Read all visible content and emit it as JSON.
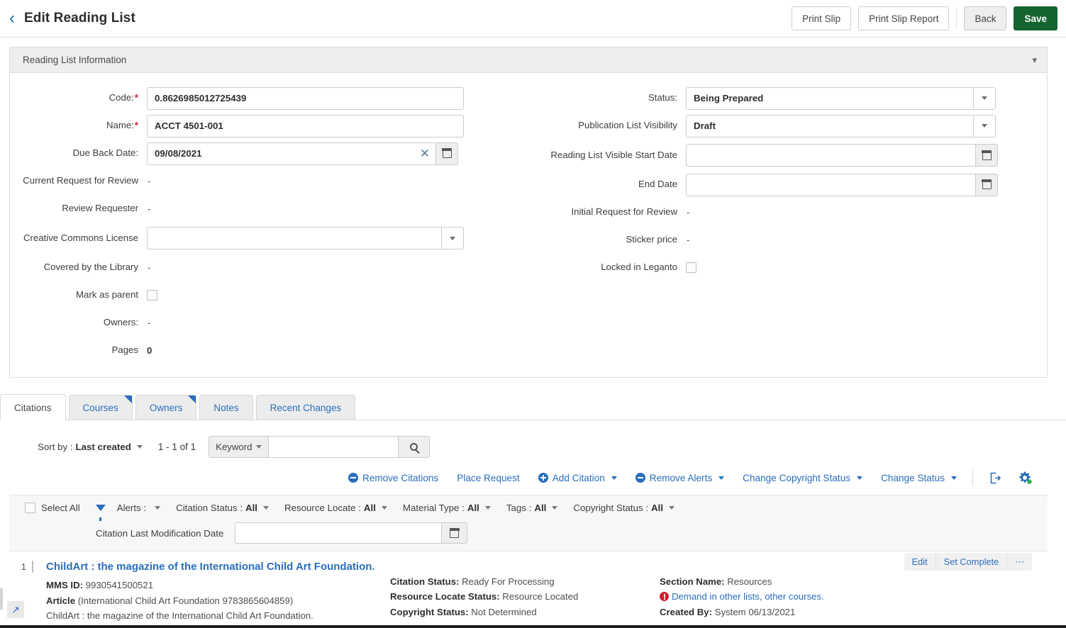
{
  "header": {
    "back_icon": "chevron-left-icon",
    "title": "Edit Reading List",
    "buttons": {
      "print_slip": "Print Slip",
      "print_slip_report": "Print Slip Report",
      "back": "Back",
      "save": "Save"
    },
    "save_color": "#14642f"
  },
  "panel": {
    "title": "Reading List Information",
    "collapse_icon": "chevron-down-icon",
    "left_fields": [
      {
        "label": "Code:",
        "required": true,
        "type": "text",
        "value": "0.8626985012725439"
      },
      {
        "label": "Name:",
        "required": true,
        "type": "text",
        "value": "ACCT 4501-001"
      },
      {
        "label": "Due Back Date:",
        "required": false,
        "type": "date",
        "value": "09/08/2021",
        "clear_icon": "clear-x-icon",
        "calendar_icon": "calendar-icon"
      },
      {
        "label": "Current Request for Review",
        "required": false,
        "type": "static",
        "value": "-"
      },
      {
        "label": "Review Requester",
        "required": false,
        "type": "static",
        "value": "-"
      },
      {
        "label": "Creative Commons License",
        "required": false,
        "type": "select",
        "value": ""
      },
      {
        "label": "Covered by the Library",
        "required": false,
        "type": "static",
        "value": "-"
      },
      {
        "label": "Mark as parent",
        "required": false,
        "type": "checkbox",
        "checked": false
      },
      {
        "label": "Owners:",
        "required": false,
        "type": "static",
        "value": "-"
      },
      {
        "label": "Pages",
        "required": false,
        "type": "static-bold",
        "value": "0"
      }
    ],
    "right_fields": [
      {
        "label": "Status:",
        "required": false,
        "type": "select",
        "value": "Being Prepared"
      },
      {
        "label": "Publication List Visibility",
        "required": false,
        "type": "select",
        "value": "Draft"
      },
      {
        "label": "Reading List Visible Start Date",
        "required": false,
        "type": "date",
        "value": "",
        "calendar_icon": "calendar-icon"
      },
      {
        "label": "End Date",
        "required": false,
        "type": "date",
        "value": "",
        "calendar_icon": "calendar-icon"
      },
      {
        "label": "Initial Request for Review",
        "required": false,
        "type": "static",
        "value": "-"
      },
      {
        "label": "Sticker price",
        "required": false,
        "type": "static",
        "value": "-"
      },
      {
        "label": "Locked in Leganto",
        "required": false,
        "type": "checkbox",
        "checked": false
      }
    ]
  },
  "tabs": [
    {
      "label": "Citations",
      "active": true,
      "corner": false
    },
    {
      "label": "Courses",
      "active": false,
      "corner": true
    },
    {
      "label": "Owners",
      "active": false,
      "corner": true
    },
    {
      "label": "Notes",
      "active": false,
      "corner": false
    },
    {
      "label": "Recent Changes",
      "active": false,
      "corner": false
    }
  ],
  "citations": {
    "sort_by_label": "Sort by :",
    "sort_by_value": "Last created",
    "count_text": "1 - 1 of 1",
    "search_scope": "Keyword",
    "search_value": "",
    "search_placeholder": "",
    "search_icon": "search-icon",
    "actions": [
      {
        "label": "Remove Citations",
        "icon": "minus-circle-icon",
        "caret": false
      },
      {
        "label": "Place Request",
        "icon": "",
        "caret": false
      },
      {
        "label": "Add Citation",
        "icon": "plus-circle-icon",
        "caret": true
      },
      {
        "label": "Remove Alerts",
        "icon": "minus-circle-icon",
        "caret": true
      },
      {
        "label": "Change Copyright Status",
        "icon": "",
        "caret": true
      },
      {
        "label": "Change Status",
        "icon": "",
        "caret": true
      }
    ],
    "tool_icons": [
      {
        "name": "export-icon"
      },
      {
        "name": "settings-gear-icon"
      }
    ],
    "filters": {
      "select_all": "Select All",
      "funnel_icon": "filter-funnel-icon",
      "items": [
        {
          "label": "Alerts :",
          "value": ""
        },
        {
          "label": "Citation Status :",
          "value": "All"
        },
        {
          "label": "Resource Locate :",
          "value": "All"
        },
        {
          "label": "Material Type :",
          "value": "All"
        },
        {
          "label": "Tags :",
          "value": "All"
        },
        {
          "label": "Copyright Status :",
          "value": "All"
        }
      ],
      "date_label": "Citation Last Modification Date",
      "date_value": "",
      "date_icon": "calendar-icon"
    },
    "rows": [
      {
        "num": "1",
        "checked": false,
        "title": "ChildArt : the magazine of the International Child Art Foundation.",
        "col1": [
          {
            "label": "MMS ID:",
            "value": " 9930541500521"
          },
          {
            "label": "Article",
            "value": " (International Child Art Foundation 9783865604859)"
          },
          {
            "label": "",
            "value": "ChildArt : the magazine of the International Child Art Foundation."
          }
        ],
        "col2": [
          {
            "label": "Citation Status:",
            "value": " Ready For Processing"
          },
          {
            "label": "Resource Locate Status:",
            "value": " Resource Located"
          },
          {
            "label": "Copyright Status:",
            "value": " Not Determined"
          }
        ],
        "col3": [
          {
            "label": "Section Name:",
            "value": " Resources"
          },
          {
            "label": "",
            "value": "Demand in other lists, other courses.",
            "alert": true
          },
          {
            "label": "Created By:",
            "value": " System 06/13/2021"
          }
        ],
        "actions": [
          "Edit",
          "Set Complete",
          "⋯"
        ]
      }
    ]
  },
  "footer": {
    "expand_icon": "expand-arrow-icon"
  }
}
